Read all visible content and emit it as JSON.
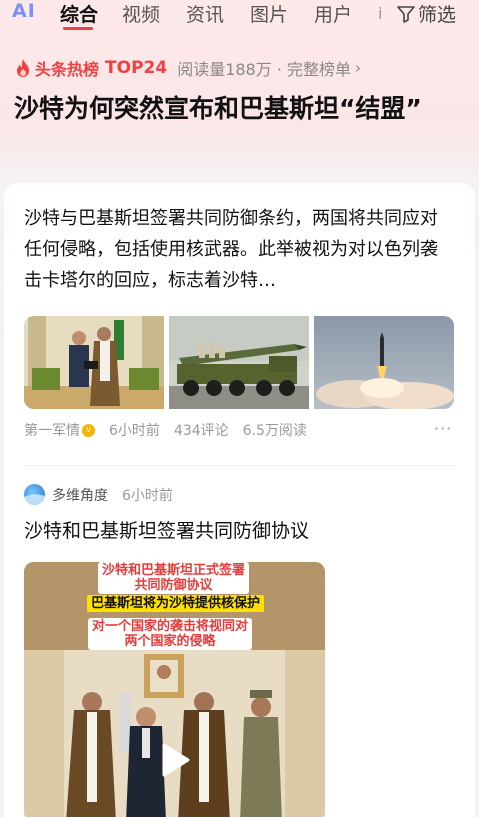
{
  "nav": {
    "logo": "AI",
    "tabs": [
      "综合",
      "视频",
      "资讯",
      "图片",
      "用户"
    ],
    "active_tab": "综合",
    "filter_label": "筛选",
    "accent": "#f04142"
  },
  "hot": {
    "label": "头条热榜",
    "rank": "TOP24",
    "reads": "阅读量188万 · 完整榜单",
    "chevron": "›"
  },
  "headline": "沙特为何突然宣布和巴基斯坦“结盟”",
  "article": {
    "summary": "沙特与巴基斯坦签署共同防御条约，两国将共同应对任何侵略，包括使用核武器。此举被视为对以色列袭击卡塔尔的回应，标志着沙特…",
    "source": "第一军情",
    "time": "6小时前",
    "comments": "434评论",
    "views": "6.5万阅读",
    "more": "···"
  },
  "post": {
    "author": "多维角度",
    "time": "6小时前",
    "title": "沙特和巴基斯坦签署共同防御协议",
    "video_captions": [
      "沙特和巴基斯坦正式签署\n共同防御协议",
      "巴基斯坦将为沙特提供核保护",
      "对一个国家的袭击将视同对\n两个国家的侵略"
    ]
  }
}
